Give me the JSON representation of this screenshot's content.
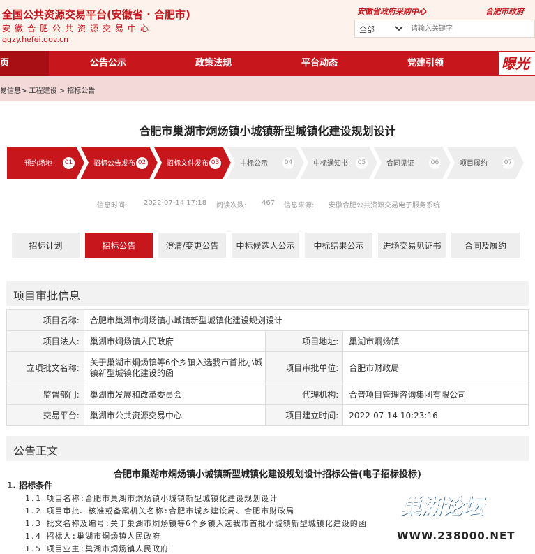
{
  "header": {
    "title": "全国公共资源交易平台(安徽省 · 合肥市)",
    "subtitle": "安徽合肥公共资源交易中心",
    "url": "ggzy.hefei.gov.cn",
    "top_link_1": "安徽省政府采购中心",
    "top_link_2": "合肥市政府",
    "search": {
      "scope": "全部",
      "placeholder": "请输入关键字"
    }
  },
  "nav": {
    "items": [
      "页",
      "公告公示",
      "政策法规",
      "平台动态",
      "党建引领"
    ],
    "logo_text": "曝光"
  },
  "breadcrumb": "易信息> 工程建设 > 招标公告",
  "page_title": "合肥市巢湖市烔炀镇小城镇新型城镇化建设规划设计",
  "steps": [
    {
      "label": "预约场地",
      "num": "01",
      "active": true
    },
    {
      "label": "招标公告发布",
      "num": "02",
      "active": true
    },
    {
      "label": "招标文件发布",
      "num": "03",
      "active": true
    },
    {
      "label": "中标公示",
      "num": "04",
      "active": false
    },
    {
      "label": "中标通知书",
      "num": "05",
      "active": false
    },
    {
      "label": "合同见证",
      "num": "06",
      "active": false
    },
    {
      "label": "项目履约",
      "num": "07",
      "active": false
    }
  ],
  "meta": {
    "time_label": "信息时间:",
    "time_value": "2022-07-14 17:18",
    "views_label": "阅读次数:",
    "views_value": "467",
    "source_label": "信息来源:",
    "source_value": "安徽合肥公共资源交易电子服务系统"
  },
  "tabs": [
    "招标计划",
    "招标公告",
    "澄清/变更公告",
    "中标候选人公示",
    "中标结果公示",
    "进场交易见证书",
    "合同及履约"
  ],
  "project": {
    "section_title": "项目审批信息",
    "name_label": "项目名称:",
    "name_value": "合肥市巢湖市烔炀镇小城镇新型城镇化建设规划设计",
    "legal_label": "项目法人:",
    "legal_value": "巢湖市烔炀镇人民政府",
    "addr_label": "项目地址:",
    "addr_value": "巢湖市烔炀镇",
    "doc_label": "立项批文名称:",
    "doc_value": "关于巢湖市烔炀镇等6个乡镇入选我市首批小城镇新型城镇化建设的函",
    "approve_label": "项目审批单位:",
    "approve_value": "合肥市财政局",
    "supervise_label": "监督部门:",
    "supervise_value": "巢湖市发展和改革委员会",
    "agent_label": "代理机构:",
    "agent_value": "合普项目管理咨询集团有限公司",
    "platform_label": "交易平台:",
    "platform_value": "巢湖市公共资源交易中心",
    "created_label": "项目建立时间:",
    "created_value": "2022-07-14 10:23:16"
  },
  "announcement": {
    "section_title": "公告正文",
    "title": "合肥市巢湖市烔炀镇小城镇新型城镇化建设规划设计招标公告(电子招标投标)",
    "heading": "1. 招标条件",
    "lines": [
      "1.1 项目名称:合肥市巢湖市烔炀镇小城镇新型城镇化建设规划设计",
      "1.2 项目审批、核准或备案机关名称:合肥市城乡建设局、合肥市财政局",
      "1.3 批文名称及编号:关于巢湖市烔炀镇等6个乡镇入选我市首批小城镇新型城镇化建设的函",
      "1.4 招标人:巢湖市烔炀镇人民政府",
      "1.5 项目业主:巢湖市烔炀镇人民政府"
    ]
  },
  "watermark": {
    "title": "巢湖论坛",
    "url": "WWW.238000.NET"
  },
  "colors": {
    "brand_red": "#c8161d",
    "inactive_step": "#eeeeee",
    "watermark_blue": "#1a6fc8"
  }
}
